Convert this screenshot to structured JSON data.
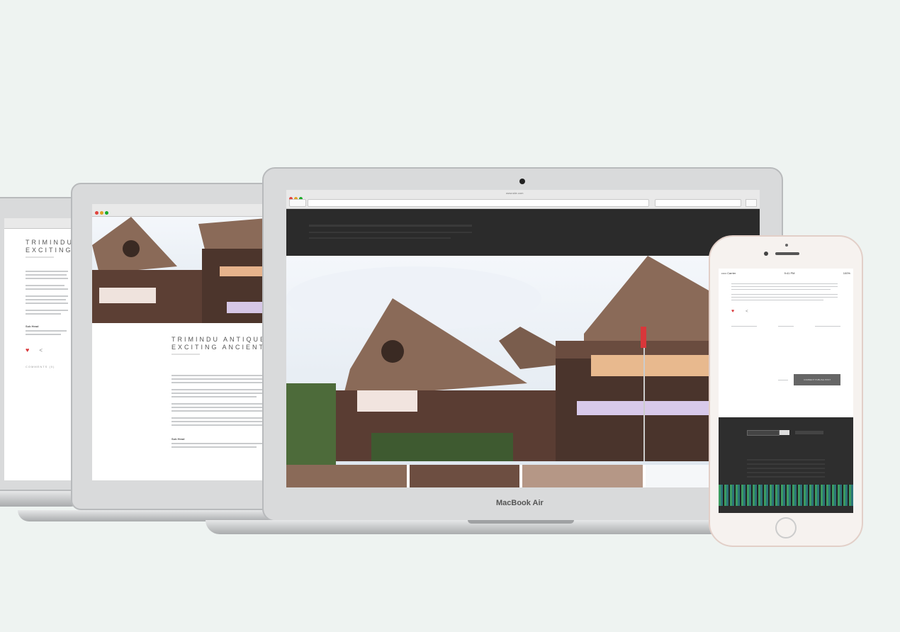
{
  "laptop_left": {
    "title_line1": "TRIMINDU",
    "title_line2": "EXCITING",
    "subheading": "Sub Head",
    "comment_label": "COMMENTS (0)"
  },
  "laptop_middle": {
    "title_line1": "TRIMINDU ANTIQUE",
    "title_line2": "EXCITING ANCIENT T",
    "subheading": "Sub Head"
  },
  "macbook": {
    "browser_title": "www.site.com",
    "brand_label": "MacBook Air"
  },
  "phone": {
    "carrier": "••••• Carrier",
    "time": "9:41 PM",
    "battery": "100%",
    "submit_button": "COMMENT PUBLISH POST"
  },
  "colors": {
    "background": "#eef3f1",
    "dark_header": "#2b2b2b",
    "accent_red": "#d9373a",
    "wood_roof": "#8a6a58",
    "footer_green": "#3fae6a"
  }
}
